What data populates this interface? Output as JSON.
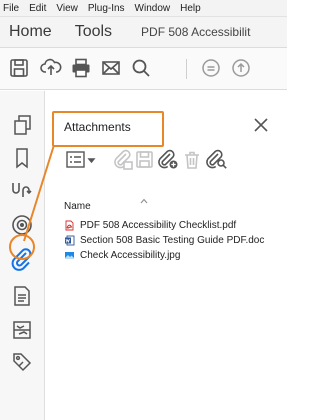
{
  "menubar": {
    "items": [
      "File",
      "Edit",
      "View",
      "Plug-Ins",
      "Window",
      "Help"
    ]
  },
  "navbar": {
    "home": "Home",
    "tools": "Tools",
    "document_tab": "PDF 508 Accessibilit"
  },
  "toolbar": {
    "icons": [
      "save-icon",
      "upload-icon",
      "print-icon",
      "email-icon",
      "search-icon",
      "scroll-up-icon",
      "page-up-icon"
    ]
  },
  "leftbar": {
    "icons": [
      "pages-icon",
      "bookmarks-icon",
      "signatures-icon",
      "layers-icon",
      "attachments-icon",
      "content-icon",
      "order-icon",
      "tags-icon"
    ],
    "active": "attachments-icon",
    "accent_color": "#1473e6"
  },
  "panel": {
    "title": "Attachments",
    "tools": [
      "options-menu-icon",
      "open-attachment-icon",
      "save-attachment-icon",
      "add-attachment-icon",
      "delete-attachment-icon",
      "search-attachment-icon"
    ],
    "column_header": "Name",
    "files": [
      {
        "name": "PDF 508 Accessibility Checklist.pdf",
        "icon": "pdf-file-icon"
      },
      {
        "name": "Section 508 Basic Testing Guide PDF.doc",
        "icon": "word-file-icon"
      },
      {
        "name": "Check Accessibility.jpg",
        "icon": "image-file-icon"
      }
    ]
  },
  "colors": {
    "highlight": "#e8862a",
    "pdf": "#d32f2f",
    "word": "#2b579a",
    "image": "#1e88e5"
  }
}
